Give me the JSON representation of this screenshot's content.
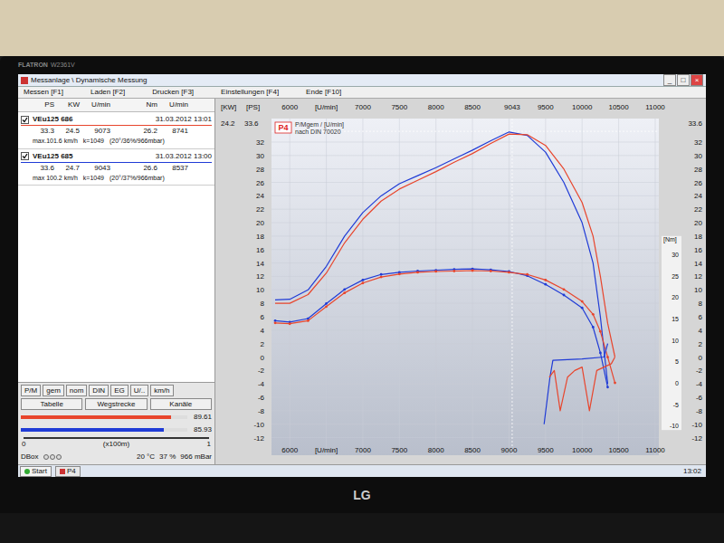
{
  "monitor": {
    "brand": "FLATRON",
    "model": "W2361V",
    "logo": "LG"
  },
  "window": {
    "title": "Messanlage \\ Dynamische Messung",
    "controls": [
      "_",
      "□",
      "×"
    ]
  },
  "menu": [
    "Messen [F1]",
    "Laden [F2]",
    "Drucken [F3]",
    "Einstellungen [F4]",
    "Ende [F10]"
  ],
  "runs_header": [
    "PS",
    "KW",
    "U/min",
    "Nm",
    "U/min"
  ],
  "runs": [
    {
      "name": "VEu125 686",
      "checked": true,
      "date": "31.03.2012 13:01",
      "values": [
        "33.3",
        "24.5",
        "9073",
        "26.2",
        "8741"
      ],
      "info": [
        "max.101.6 km/h",
        "k=1049",
        "(20°/36%/966mbar)"
      ],
      "color": "#e8452c"
    },
    {
      "name": "VEu125 685",
      "checked": true,
      "date": "31.03.2012 13:00",
      "values": [
        "33.6",
        "24.7",
        "9043",
        "26.6",
        "8537"
      ],
      "info": [
        "max 100.2 km/h",
        "k=1049",
        "(20°/37%/966mbar)"
      ],
      "color": "#1f3bd6"
    }
  ],
  "view_buttons": [
    "P/M",
    "gem",
    "nom",
    "DIN",
    "EG",
    "U/..",
    "km/h"
  ],
  "tool_buttons": [
    "Tabelle",
    "Wegstrecke",
    "Kanäle"
  ],
  "bars": [
    {
      "reading": "89.61",
      "level": 0.9,
      "color": "#e8452c"
    },
    {
      "reading": "85.93",
      "level": 0.86,
      "color": "#1f3bd6"
    }
  ],
  "scale": [
    "0",
    "(x100m)",
    "1"
  ],
  "status": {
    "label": "DBox",
    "lights": [
      {
        "on": false
      },
      {
        "on": false
      },
      {
        "on": false
      }
    ],
    "temperature": "20 °C",
    "humidity": "37 %",
    "pressure": "966 mBar"
  },
  "taskbar": {
    "start": "Start",
    "apps": [
      "P4"
    ],
    "clock": "13:02"
  },
  "chart": {
    "badge": "P4",
    "legend": [
      "P/Mgem / [U/min]",
      "nach DIN 70020"
    ],
    "left_units": [
      "[KW]",
      "[PS]"
    ],
    "left_peak": [
      "24.2",
      "33.6"
    ],
    "right_peak": "33.6",
    "nm_unit": "[Nm]",
    "peak": {
      "rpm": 9043,
      "ps": 33.6
    },
    "ps_ticks": [
      "32",
      "30",
      "28",
      "26",
      "24",
      "22",
      "20",
      "18",
      "16",
      "14",
      "12",
      "10",
      "8",
      "6",
      "4",
      "2",
      "0",
      "-2",
      "-4",
      "-6",
      "-8",
      "-10",
      "-12"
    ],
    "nm_ticks": [
      "30",
      "25",
      "20",
      "15",
      "10",
      "5",
      "0",
      "-5",
      "-10"
    ],
    "x_ticks_top": [
      {
        "rpm": 6000,
        "label": "6000"
      },
      {
        "rpm": 6500,
        "label": "[U/min]"
      },
      {
        "rpm": 7000,
        "label": "7000"
      },
      {
        "rpm": 7500,
        "label": "7500"
      },
      {
        "rpm": 8000,
        "label": "8000"
      },
      {
        "rpm": 8500,
        "label": "8500"
      },
      {
        "rpm": 9043,
        "label": "9043"
      },
      {
        "rpm": 9500,
        "label": "9500"
      },
      {
        "rpm": 10000,
        "label": "10000"
      },
      {
        "rpm": 10500,
        "label": "10500"
      },
      {
        "rpm": 11000,
        "label": "11000"
      }
    ],
    "x_ticks_bottom": [
      {
        "rpm": 6000,
        "label": "6000"
      },
      {
        "rpm": 6500,
        "label": "[U/min]"
      },
      {
        "rpm": 7000,
        "label": "7000"
      },
      {
        "rpm": 7500,
        "label": "7500"
      },
      {
        "rpm": 8000,
        "label": "8000"
      },
      {
        "rpm": 8500,
        "label": "8500"
      },
      {
        "rpm": 9000,
        "label": "9000"
      },
      {
        "rpm": 9500,
        "label": "9500"
      },
      {
        "rpm": 10000,
        "label": "10000"
      },
      {
        "rpm": 10500,
        "label": "10500"
      },
      {
        "rpm": 11000,
        "label": "11000"
      }
    ],
    "series": [
      {
        "name": "power-685",
        "kind": "power",
        "color": "#1f3bd6",
        "rpm": [
          5800,
          6000,
          6250,
          6500,
          6750,
          7000,
          7250,
          7500,
          7750,
          8000,
          8250,
          8500,
          8750,
          9000,
          9250,
          9500,
          9750,
          10000,
          10150,
          10250,
          10350
        ],
        "values": [
          8.5,
          8.6,
          10,
          13.5,
          18,
          21.5,
          24,
          25.8,
          27,
          28.2,
          29.5,
          30.8,
          32.2,
          33.5,
          33,
          30.5,
          26,
          20,
          14,
          6,
          -4
        ]
      },
      {
        "name": "power-686",
        "kind": "power",
        "color": "#e8452c",
        "rpm": [
          5800,
          6000,
          6250,
          6500,
          6750,
          7000,
          7250,
          7500,
          7750,
          8000,
          8250,
          8500,
          8750,
          9000,
          9250,
          9500,
          9750,
          10000,
          10150,
          10250,
          10350,
          10450
        ],
        "values": [
          8,
          8,
          9.3,
          12.5,
          17,
          20.5,
          23.2,
          25,
          26.3,
          27.6,
          29,
          30.3,
          31.8,
          33.2,
          33.1,
          31.5,
          28,
          23,
          18,
          12,
          5,
          0
        ]
      },
      {
        "name": "torque-685",
        "kind": "torque",
        "color": "#1f3bd6",
        "rpm": [
          5800,
          6000,
          6250,
          6500,
          6750,
          7000,
          7250,
          7500,
          7750,
          8000,
          8250,
          8500,
          8750,
          9000,
          9250,
          9500,
          9750,
          10000,
          10150,
          10250,
          10350
        ],
        "values": [
          14.5,
          14.2,
          15,
          18.5,
          21.8,
          24,
          25.3,
          25.8,
          26.1,
          26.3,
          26.5,
          26.6,
          26.4,
          26,
          25,
          23,
          20.5,
          17.5,
          13,
          7,
          -1
        ]
      },
      {
        "name": "torque-686",
        "kind": "torque",
        "color": "#e8452c",
        "rpm": [
          5800,
          6000,
          6250,
          6500,
          6750,
          7000,
          7250,
          7500,
          7750,
          8000,
          8250,
          8500,
          8750,
          9000,
          9250,
          9500,
          9750,
          10000,
          10150,
          10250,
          10350,
          10450
        ],
        "values": [
          14,
          13.8,
          14.5,
          17.8,
          21,
          23.3,
          24.7,
          25.4,
          25.8,
          26,
          26.1,
          26.2,
          26.1,
          25.8,
          25.3,
          24,
          21.8,
          19,
          16,
          12,
          6,
          0
        ]
      },
      {
        "name": "coast-685",
        "kind": "coastdown",
        "color": "#1f3bd6",
        "rpm": [
          9480,
          9560,
          9600,
          10000,
          10300,
          10350
        ],
        "values": [
          -10,
          -3,
          -0.5,
          -0.3,
          0,
          2
        ]
      },
      {
        "name": "coast-686",
        "kind": "coastdown",
        "color": "#e8452c",
        "rpm": [
          9550,
          9620,
          9700,
          9800,
          9900,
          10000,
          10100,
          10200,
          10300,
          10400,
          10450
        ],
        "values": [
          -3,
          -2,
          -8,
          -3,
          -2,
          -1.5,
          -8,
          -2,
          -1.5,
          -1,
          0
        ]
      }
    ]
  }
}
